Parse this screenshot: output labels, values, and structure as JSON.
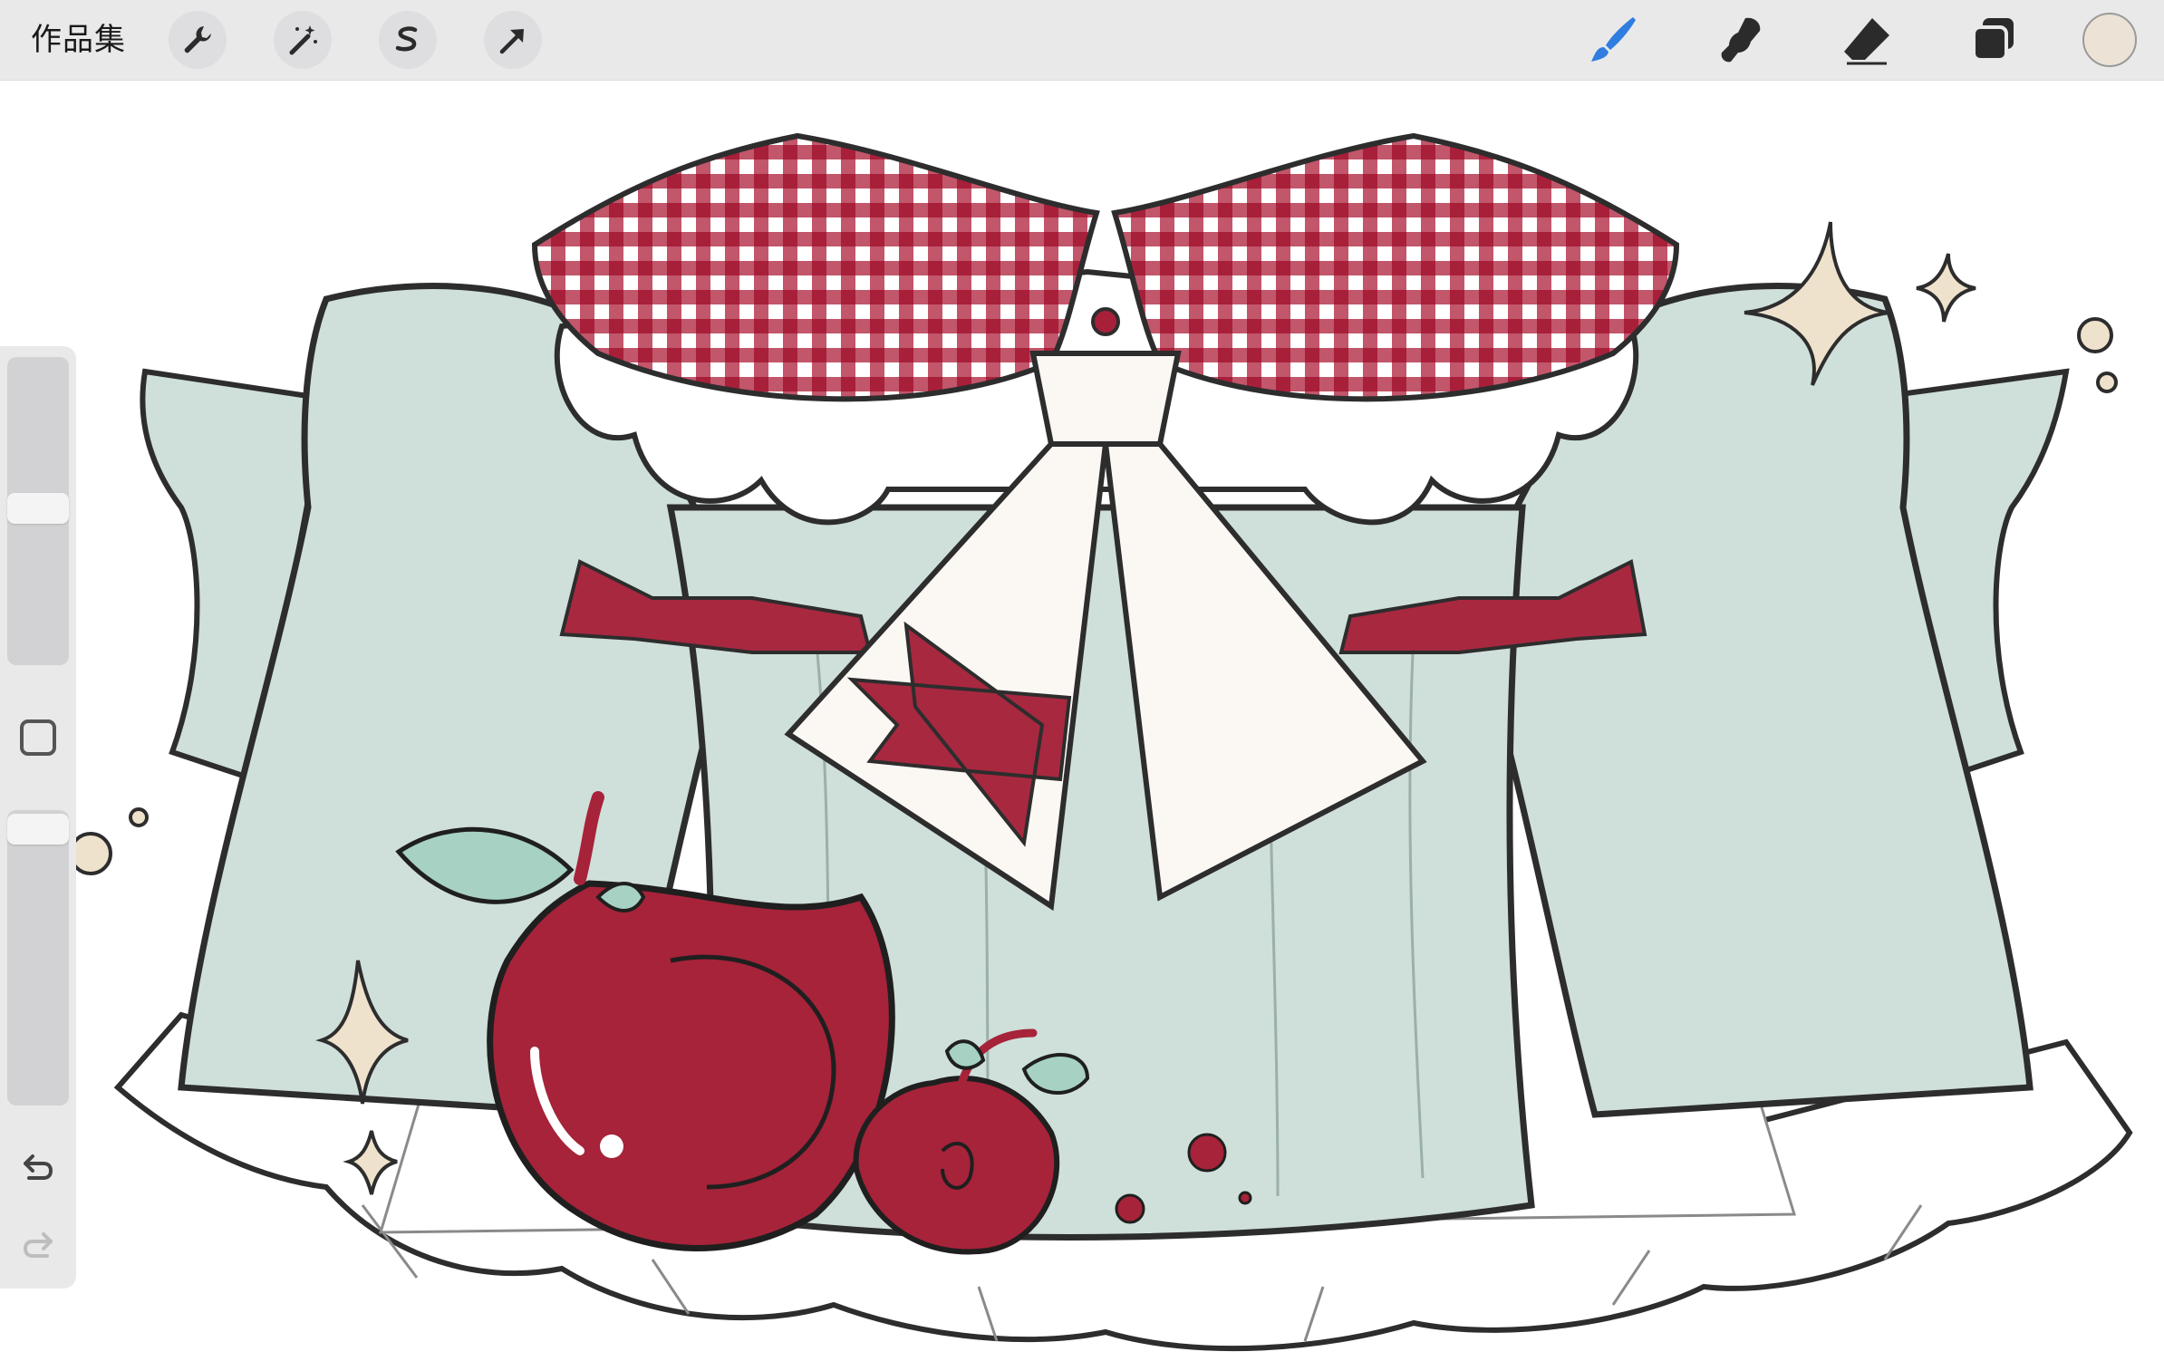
{
  "toolbar": {
    "gallery_label": "作品集",
    "left_tools": [
      "wrench-icon",
      "magic-wand-icon",
      "selection-icon",
      "transform-arrow-icon"
    ],
    "right_tools": [
      "brush-icon",
      "smudge-icon",
      "eraser-icon",
      "layers-icon"
    ],
    "active_tool": "brush",
    "accent_color": "#2f7de0",
    "current_color": "#ece3d6"
  },
  "sidebar": {
    "brush_size_level": 0.5,
    "opacity_level": 0.95,
    "controls": [
      "brush-size-slider",
      "modify-button",
      "opacity-slider",
      "undo-icon",
      "redo-icon"
    ]
  },
  "canvas": {
    "palette": {
      "dress": "#cfdfda",
      "gingham": "#b3253f",
      "bow": "#a82840",
      "cravat": "#fbf7f3",
      "apple": "#a62339",
      "leaf": "#a6d1c3",
      "sparkle": "#efe2cd",
      "outline": "#2d2d2d"
    }
  }
}
